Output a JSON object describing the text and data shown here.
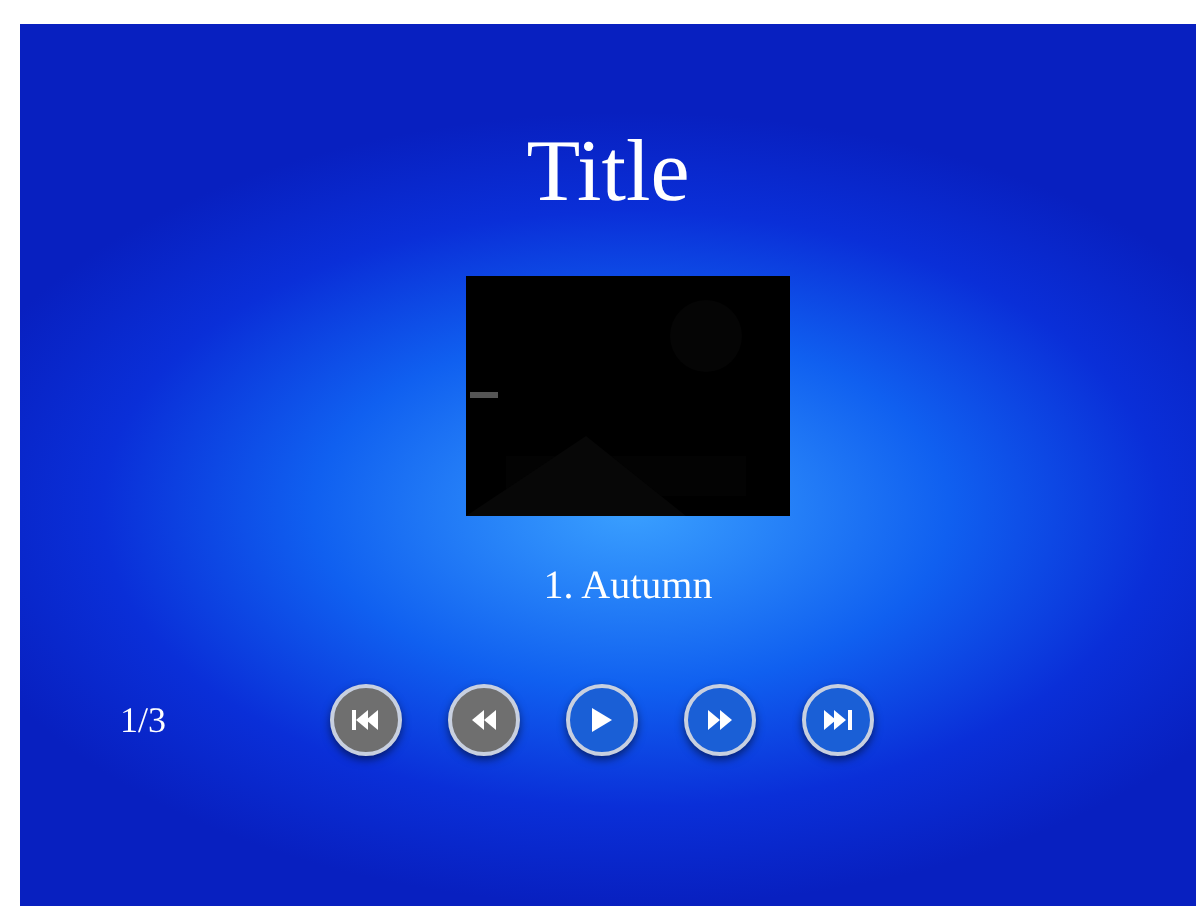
{
  "title": "Title",
  "track": "1. Autumn",
  "counter": "1/3",
  "buttons": [
    {
      "kind": "first",
      "disabled": true
    },
    {
      "kind": "rewind",
      "disabled": true
    },
    {
      "kind": "play",
      "disabled": false
    },
    {
      "kind": "forward",
      "disabled": false
    },
    {
      "kind": "last",
      "disabled": false
    }
  ]
}
